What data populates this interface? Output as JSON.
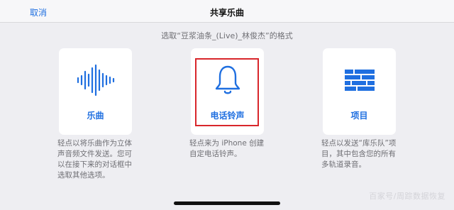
{
  "navbar": {
    "cancel_label": "取消",
    "title": "共享乐曲"
  },
  "subtitle": "选取“豆浆油条_(Live)_林俊杰”的格式",
  "options": [
    {
      "icon": "waveform-icon",
      "label": "乐曲",
      "description": "轻点以将乐曲作为立体声音频文件发送。您可以在接下来的对话框中选取其他选项。"
    },
    {
      "icon": "bell-icon",
      "label": "电话铃声",
      "description": "轻点来为 iPhone 创建自定电话铃声。"
    },
    {
      "icon": "tracks-icon",
      "label": "项目",
      "description": "轻点以发送“库乐队”项目，其中包含您的所有多轨道录音。"
    }
  ],
  "highlighted_option": "电话铃声",
  "watermark": "百家号/周踪数据恢复",
  "colors": {
    "accent": "#1f6fe0",
    "highlight_border": "#d8262b",
    "background": "#eeeef2",
    "card": "#ffffff"
  }
}
